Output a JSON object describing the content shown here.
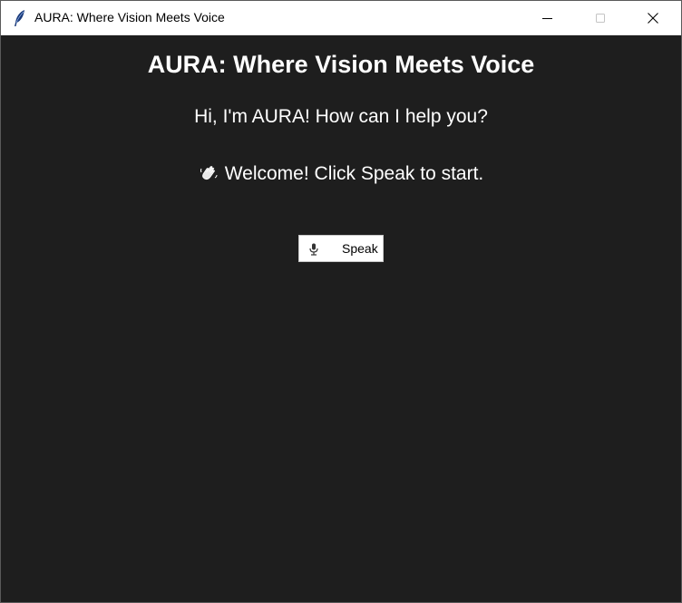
{
  "window": {
    "title": "AURA: Where Vision Meets Voice",
    "app_icon": "feather-icon",
    "controls": [
      "minimize-icon",
      "maximize-icon",
      "close-icon"
    ]
  },
  "main": {
    "heading": "AURA: Where Vision Meets Voice",
    "greeting": "Hi, I'm AURA! How can I help you?",
    "status_icon": "waving-hand-icon",
    "status_text": "Welcome! Click Speak to start.",
    "speak_button": {
      "icon": "microphone-icon",
      "label": "Speak"
    }
  },
  "colors": {
    "background": "#1e1e1e",
    "text": "#ffffff",
    "titlebar": "#ffffff",
    "button_bg": "#ffffff"
  }
}
